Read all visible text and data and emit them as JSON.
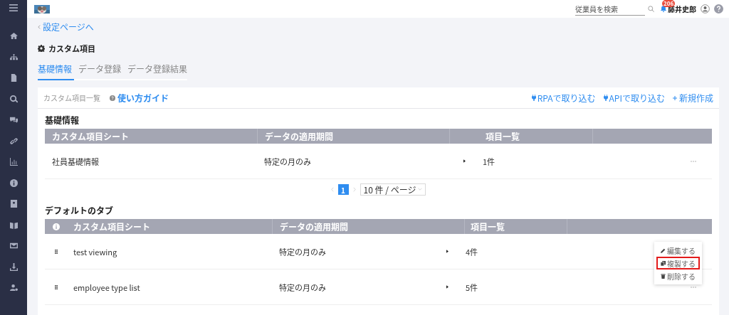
{
  "top_bar": {
    "search": {
      "placeholder": "従業員を検索"
    },
    "notification_count": "206",
    "user_name": "藤井史郎"
  },
  "back_link": "設定ページへ",
  "page_title": "カスタム項目",
  "tabs": [
    {
      "label": "基礎情報",
      "selected": true
    },
    {
      "label": "データ登録",
      "selected": false
    },
    {
      "label": "データ登録結果",
      "selected": false
    }
  ],
  "card_toolbar": {
    "title": "カスタム項目一覧",
    "guide_link": "使い方ガイド",
    "actions": [
      {
        "label": "RPAで取り込む",
        "kind": "plug"
      },
      {
        "label": "APIで取り込む",
        "kind": "plug"
      },
      {
        "label": "新規作成",
        "kind": "add"
      }
    ]
  },
  "sections": [
    {
      "title": "基礎情報",
      "kind": "plain",
      "columns": [
        "カスタム項目シート",
        "データの適用期間",
        "項目一覧"
      ],
      "rows": [
        {
          "sheet": "社員基礎情報",
          "period": "特定の月のみ",
          "count": "1件"
        }
      ],
      "pagination": {
        "pages": [
          {
            "label": "1",
            "selected": true
          }
        ],
        "page_size": "10 件 / ページ"
      }
    },
    {
      "title": "デフォルトのタブ",
      "kind": "draggable",
      "columns": [
        "カスタム項目シート",
        "データの適用期間",
        "項目一覧"
      ],
      "rows": [
        {
          "sheet": "test viewing",
          "period": "特定の月のみ",
          "count": "4件",
          "menu": [
            {
              "label": "編集する",
              "kind": "edit",
              "highlighted": false
            },
            {
              "label": "複製する",
              "kind": "copy",
              "highlighted": true
            },
            {
              "label": "削除する",
              "kind": "delete",
              "highlighted": false
            }
          ]
        },
        {
          "sheet": "employee type list",
          "period": "特定の月のみ",
          "count": "5件"
        }
      ]
    }
  ]
}
